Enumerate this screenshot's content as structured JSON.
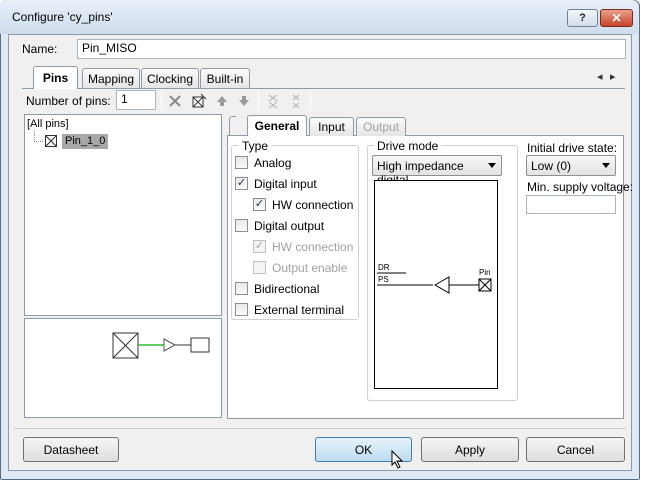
{
  "window": {
    "title": "Configure 'cy_pins'",
    "help_label": "?",
    "close_label": "✕"
  },
  "name": {
    "label": "Name:",
    "value": "Pin_MISO"
  },
  "tabs": [
    {
      "label": "Pins",
      "active": true
    },
    {
      "label": "Mapping"
    },
    {
      "label": "Clocking"
    },
    {
      "label": "Built-in"
    }
  ],
  "tab_scroll": {
    "left": "◂",
    "right": "▸"
  },
  "toolbar": {
    "num_pins_label": "Number of pins:",
    "num_pins_value": "1",
    "icons": [
      "delete-icon",
      "add-pin-icon",
      "move-up-icon",
      "move-down-icon",
      "group-icon",
      "ungroup-icon"
    ]
  },
  "tree": {
    "root": "[All pins]",
    "child": "Pin_1_0"
  },
  "subtabs": [
    {
      "label": "General",
      "active": true
    },
    {
      "label": "Input"
    },
    {
      "label": "Output",
      "disabled": true
    }
  ],
  "type_group": {
    "legend": "Type",
    "options": [
      {
        "label": "Analog",
        "checked": false
      },
      {
        "label": "Digital input",
        "checked": true
      },
      {
        "label": "HW connection",
        "checked": true
      },
      {
        "label": "Digital output",
        "checked": false
      },
      {
        "label": "HW connection",
        "checked": true,
        "disabled": true
      },
      {
        "label": "Output enable",
        "checked": false,
        "disabled": true
      },
      {
        "label": "Bidirectional",
        "checked": false
      },
      {
        "label": "External terminal",
        "checked": false
      }
    ]
  },
  "drive_mode": {
    "legend": "Drive mode",
    "selected": "High impedance digital",
    "diagram": {
      "dr": "DR",
      "ps": "PS",
      "pin": "Pin"
    }
  },
  "initial_drive": {
    "label": "Initial drive state:",
    "selected": "Low (0)"
  },
  "min_supply": {
    "label": "Min. supply voltage:",
    "value": ""
  },
  "buttons": {
    "datasheet": "Datasheet",
    "ok": "OK",
    "apply": "Apply",
    "cancel": "Cancel"
  },
  "colors": {
    "accent": "#3c7fb1",
    "wire_green": "#2fbf2f"
  }
}
